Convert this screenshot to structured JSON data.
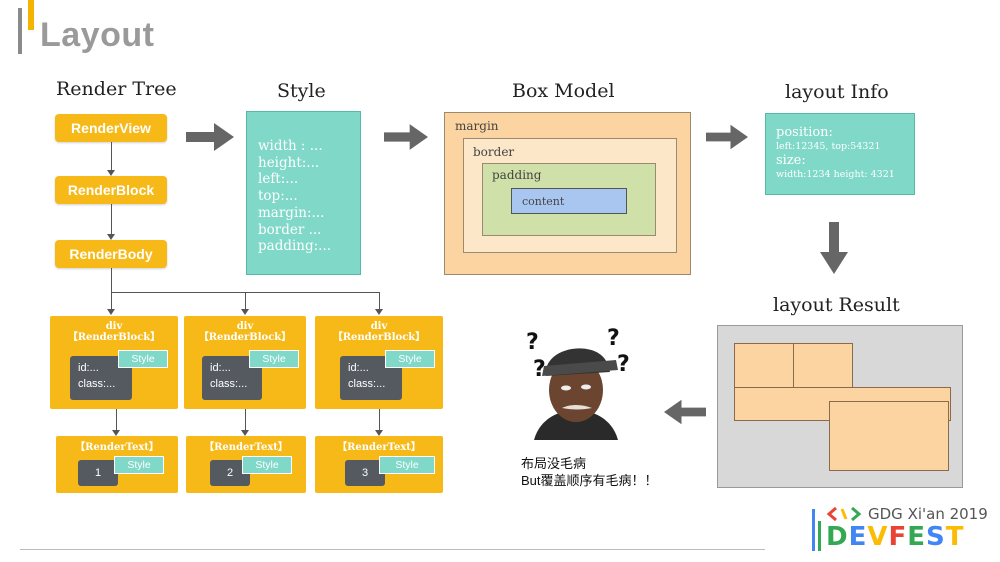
{
  "title": "Layout",
  "columns": {
    "render_tree": "Render Tree",
    "style": "Style",
    "box_model": "Box Model",
    "layout_info": "layout Info",
    "layout_result": "layout Result"
  },
  "render_tree": {
    "nodes": [
      "RenderView",
      "RenderBlock",
      "RenderBody"
    ]
  },
  "style_props": [
    "width : ...",
    "height:...",
    "left:...",
    "top:...",
    "margin:...",
    "border ...",
    "padding:..."
  ],
  "box_model": {
    "margin": "margin",
    "border": "border",
    "padding": "padding",
    "content": "content"
  },
  "layout_info": {
    "position_label": "position:",
    "position_value": "left:12345, top:54321",
    "size_label": "size:",
    "size_value": "width:1234  height: 4321"
  },
  "div_cards": [
    {
      "line1": "div",
      "line2": "【RenderBlock】",
      "id": "id:...",
      "class": "class:...",
      "style": "Style"
    },
    {
      "line1": "div",
      "line2": "【RenderBlock】",
      "id": "id:...",
      "class": "class:...",
      "style": "Style"
    },
    {
      "line1": "div",
      "line2": "【RenderBlock】",
      "id": "id:...",
      "class": "class:...",
      "style": "Style"
    }
  ],
  "text_cards": [
    {
      "label": "【RenderText】",
      "num": "1",
      "style": "Style"
    },
    {
      "label": "【RenderText】",
      "num": "2",
      "style": "Style"
    },
    {
      "label": "【RenderText】",
      "num": "3",
      "style": "Style"
    }
  ],
  "meme": {
    "caption_line1": "布局没毛病",
    "caption_line2": "But覆盖顺序有毛病！！",
    "question_mark": "?"
  },
  "footer": {
    "gdg": "GDG Xi'an 2019",
    "devfest": [
      "D",
      "E",
      "V",
      "F",
      "E",
      "S",
      "T"
    ],
    "devfest_colors": [
      "#34a853",
      "#4285f4",
      "#fbbc05",
      "#ea4335",
      "#34a853",
      "#4285f4",
      "#fbbc05"
    ]
  },
  "colors": {
    "orange": "#f6b917",
    "teal": "#7fd8c8",
    "peach": "#fcd4a1",
    "arrow_gray": "#666666"
  }
}
